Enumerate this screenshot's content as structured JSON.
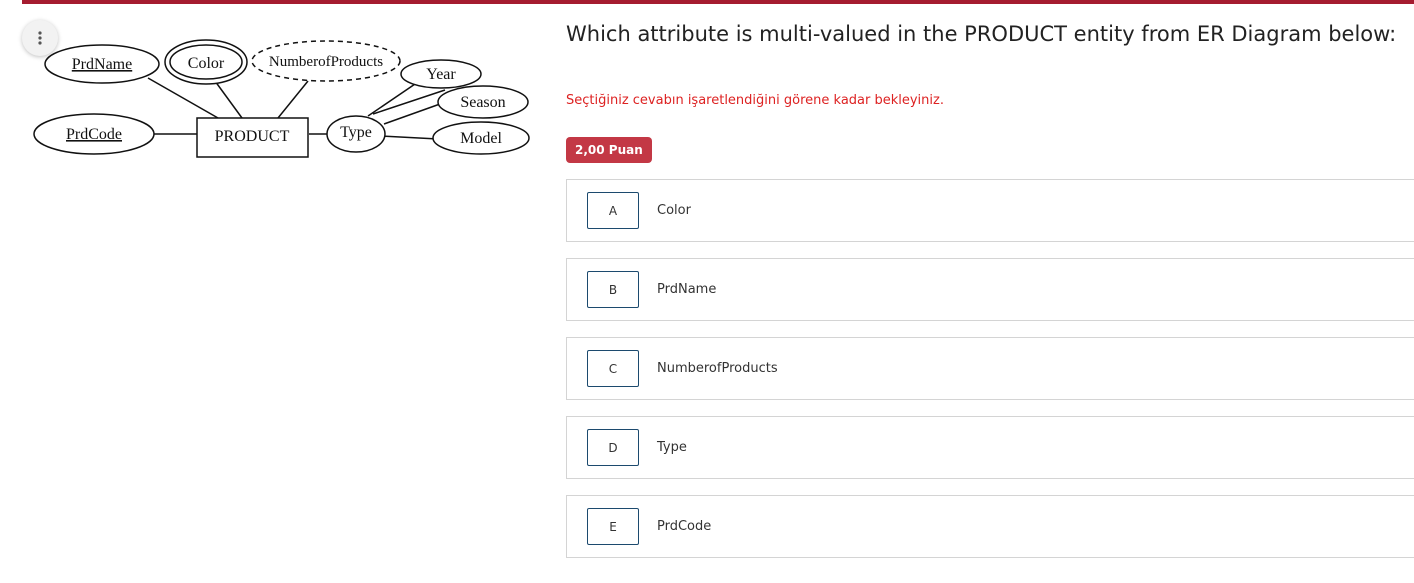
{
  "menu": {
    "icon": "vertical-dots-icon"
  },
  "diagram": {
    "entity": "PRODUCT",
    "attributes": {
      "prd_name": "PrdName",
      "color": "Color",
      "number_of_products": "NumberofProducts",
      "prd_code": "PrdCode",
      "type": "Type",
      "year": "Year",
      "season": "Season",
      "model": "Model"
    }
  },
  "question": {
    "text": "Which attribute is multi-valued in the PRODUCT entity from ER Diagram below:",
    "notice": "Seçtiğiniz cevabın işaretlendiğini görene kadar bekleyiniz.",
    "points": "2,00 Puan"
  },
  "options": [
    {
      "letter": "A",
      "text": "Color"
    },
    {
      "letter": "B",
      "text": "PrdName"
    },
    {
      "letter": "C",
      "text": "NumberofProducts"
    },
    {
      "letter": "D",
      "text": "Type"
    },
    {
      "letter": "E",
      "text": "PrdCode"
    }
  ],
  "colors": {
    "accent_bar": "#a51c30",
    "badge": "#c33845",
    "notice": "#dd2222",
    "option_border": "#1c4a6e"
  }
}
